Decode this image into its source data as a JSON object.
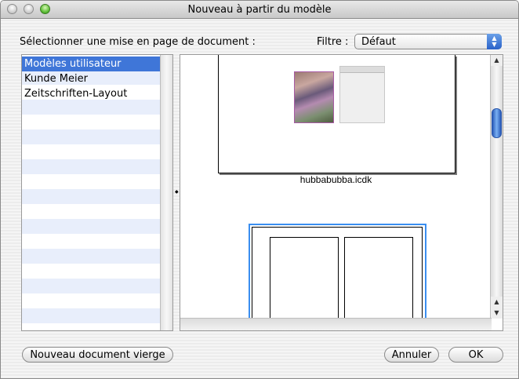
{
  "window": {
    "title": "Nouveau à partir du modèle"
  },
  "dialog": {
    "select_label": "Sélectionner une mise en page de document :",
    "filter_label": "Filtre :",
    "filter_value": "Défaut"
  },
  "list": {
    "items": [
      {
        "label": "Modèles utilisateur",
        "selected": true
      },
      {
        "label": "Kunde Meier",
        "selected": false
      },
      {
        "label": "Zeitschriften-Layout",
        "selected": false
      }
    ]
  },
  "preview": {
    "templates": [
      {
        "caption": "hubbabubba.icdk"
      }
    ]
  },
  "buttons": {
    "new_blank": "Nouveau document vierge",
    "cancel": "Annuler",
    "ok": "OK"
  },
  "colors": {
    "selection": "#3f76d8",
    "accent": "#3a8ef0"
  }
}
